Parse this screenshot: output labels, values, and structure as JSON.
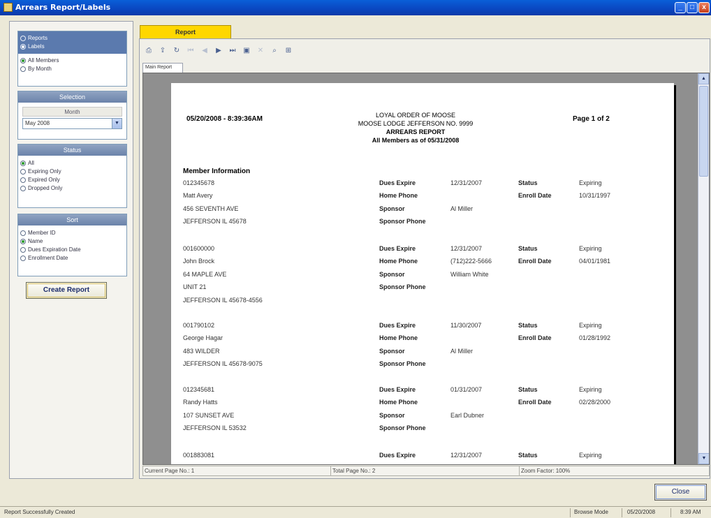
{
  "window": {
    "title": "Arrears Report/Labels",
    "controls": [
      "_",
      "□",
      "x"
    ]
  },
  "left": {
    "report_type": [
      "Reports",
      "Labels"
    ],
    "scope": [
      "All Members",
      "By Month"
    ],
    "selection": {
      "header": "Selection",
      "month_label": "Month",
      "month_value": "May 2008"
    },
    "status": {
      "header": "Status",
      "options": [
        "All",
        "Expiring Only",
        "Expired Only",
        "Dropped Only"
      ]
    },
    "sort": {
      "header": "Sort",
      "options": [
        "Member ID",
        "Name",
        "Dues Expiration Date",
        "Enrollment Date"
      ]
    },
    "create_label": "Create Report"
  },
  "report_tab": "Report",
  "inner_tab": "Main Report",
  "toolbar_icons": [
    "print-icon",
    "export-icon",
    "refresh-icon",
    "first-page-icon",
    "prev-page-icon",
    "next-page-icon",
    "last-page-icon",
    "goto-page-icon",
    "stop-icon",
    "search-icon",
    "zoom-icon"
  ],
  "report": {
    "date": "05/20/2008 - 8:39:36AM",
    "header": [
      "LOYAL ORDER OF MOOSE",
      "MOOSE LODGE JEFFERSON NO. 9999",
      "ARREARS REPORT",
      "All Members as of 05/31/2008"
    ],
    "page": "Page 1 of 2",
    "section": "Member Information",
    "labels": {
      "dues": "Dues Expire",
      "home": "Home Phone",
      "sponsor": "Sponsor",
      "sponsor_phone": "Sponsor Phone",
      "status": "Status",
      "enroll": "Enroll Date"
    },
    "records": [
      {
        "info": [
          "012345678",
          "Matt Avery",
          "456 SEVENTH AVE",
          "JEFFERSON IL 45678"
        ],
        "dues": "12/31/2007",
        "home": "",
        "sponsor": "Al Miller",
        "status": "Expiring",
        "enroll": "10/31/1997"
      },
      {
        "info": [
          "001600000",
          "John Brock",
          "64 MAPLE AVE",
          "UNIT 21",
          "JEFFERSON IL 45678-4556"
        ],
        "dues": "12/31/2007",
        "home": "(712)222-5666",
        "sponsor": "William White",
        "status": "Expiring",
        "enroll": "04/01/1981"
      },
      {
        "info": [
          "001790102",
          "George Hagar",
          "483 WILDER",
          "JEFFERSON IL 45678-9075"
        ],
        "dues": "11/30/2007",
        "home": "",
        "sponsor": "Al Miller",
        "status": "Expiring",
        "enroll": "01/28/1992"
      },
      {
        "info": [
          "012345681",
          "Randy Hatts",
          "107 SUNSET AVE",
          "JEFFERSON IL 53532"
        ],
        "dues": "01/31/2007",
        "home": "",
        "sponsor": "Earl Dubner",
        "status": "Expiring",
        "enroll": "02/28/2000"
      },
      {
        "info": [
          "001883081",
          "",
          "",
          ""
        ],
        "dues": "12/31/2007",
        "home": "",
        "sponsor": "",
        "status": "Expiring",
        "enroll": ""
      }
    ]
  },
  "strip": {
    "current": "Current Page No.: 1",
    "total": "Total Page No.: 2",
    "zoom": "Zoom Factor: 100%"
  },
  "close_label": "Close",
  "statusbar": {
    "message": "Report Successfully Created",
    "mode": "Browse Mode",
    "date": "05/20/2008",
    "time": "8:39 AM"
  }
}
